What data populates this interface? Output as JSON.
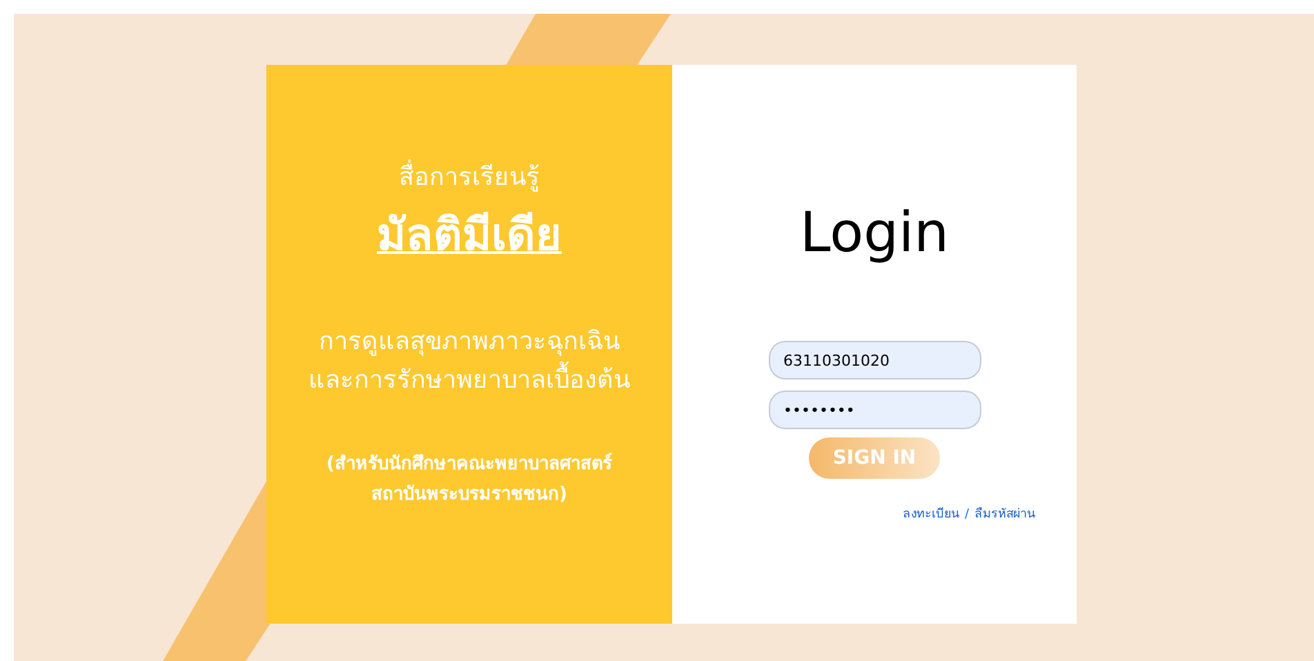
{
  "intro": {
    "subtitle": "สื่อการเรียนรู้",
    "title": "มัลติมีเดีย",
    "course": [
      "การดูแลสุขภาพภาวะฉุกเฉิน",
      "และการรักษาพยาบาลเบื้องต้น"
    ],
    "audience": [
      "(สำหรับนักศึกษาคณะพยาบาลศาสตร์",
      "สถาบันพระบรมราชชนก)"
    ]
  },
  "login": {
    "heading": "Login",
    "username": "63110301020",
    "password": "••••••••",
    "button": "SIGN IN",
    "links": [
      {
        "label": "ลงทะเบียน"
      },
      {
        "label": "ลืมรหัสผ่าน"
      }
    ],
    "separator": "/"
  }
}
